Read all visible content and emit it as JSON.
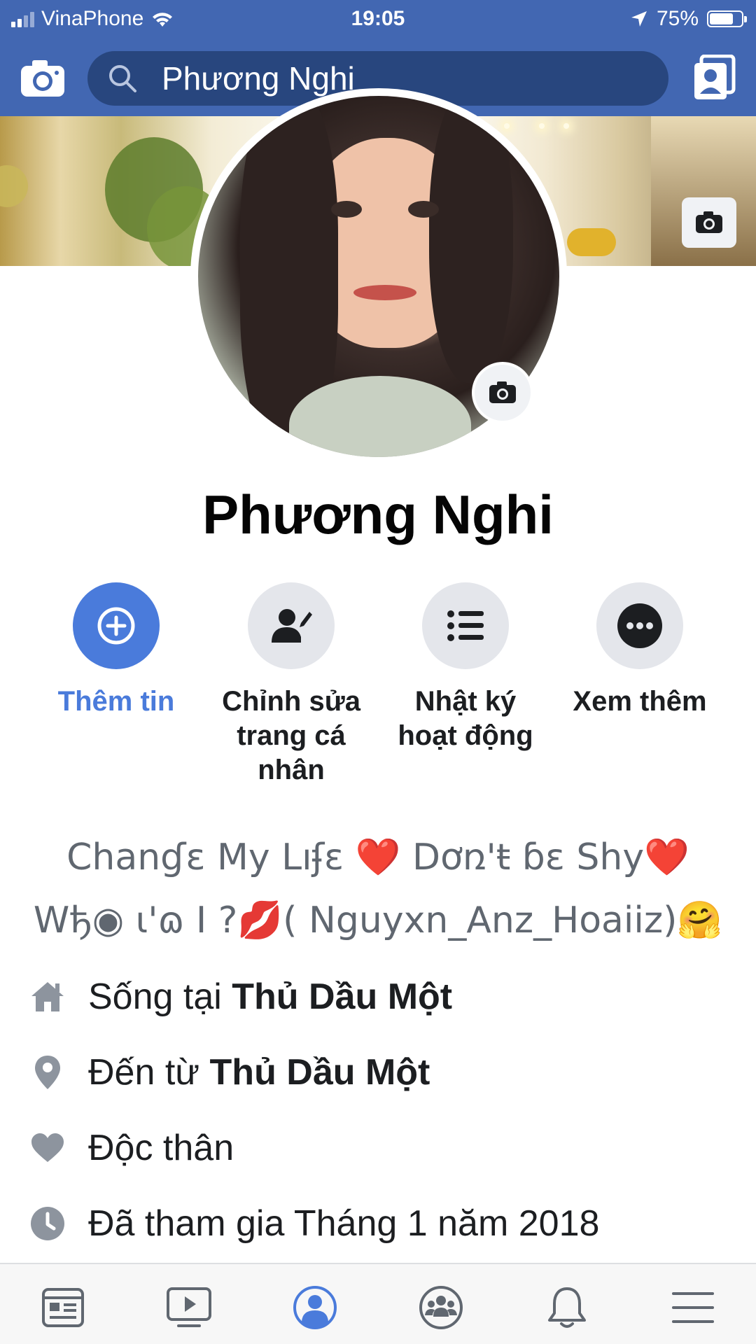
{
  "status_bar": {
    "carrier": "VinaPhone",
    "time": "19:05",
    "battery_percent": "75%",
    "battery_level": 0.75
  },
  "nav": {
    "search_value": "Phương Nghi"
  },
  "profile": {
    "name": "Phương Nghi"
  },
  "actions": [
    {
      "label": "Thêm tin",
      "icon": "plus-icon"
    },
    {
      "label": "Chỉnh sửa trang cá nhân",
      "icon": "edit-profile-icon"
    },
    {
      "label": "Nhật ký hoạt động",
      "icon": "list-icon"
    },
    {
      "label": "Xem thêm",
      "icon": "more-icon"
    }
  ],
  "bio": {
    "line1": "Chanɠɛ My Lıʄɛ ❤️ Dơռ'ŧ ɓɛ Shy❤️",
    "line2": "Wђ◉ ɩ'ɷ I ?💋( Nguyxn_Anz_Hoaiiz)🤗"
  },
  "details": [
    {
      "prefix": "Sống tại ",
      "strong": "Thủ Dầu Một",
      "icon": "home-icon"
    },
    {
      "prefix": "Đến từ ",
      "strong": "Thủ Dầu Một",
      "icon": "location-pin-icon"
    },
    {
      "prefix": "Độc thân",
      "strong": "",
      "icon": "heart-icon"
    },
    {
      "prefix": "Đã tham gia Tháng 1 năm 2018",
      "strong": "",
      "icon": "clock-icon"
    }
  ],
  "tabs": [
    "news-feed-icon",
    "watch-icon",
    "profile-icon",
    "groups-icon",
    "notifications-icon",
    "menu-icon"
  ],
  "colors": {
    "brand_blue": "#4267b2",
    "search_bg": "#28467e",
    "accent_blue": "#4a7bdb",
    "icon_gray": "#8d949e"
  }
}
